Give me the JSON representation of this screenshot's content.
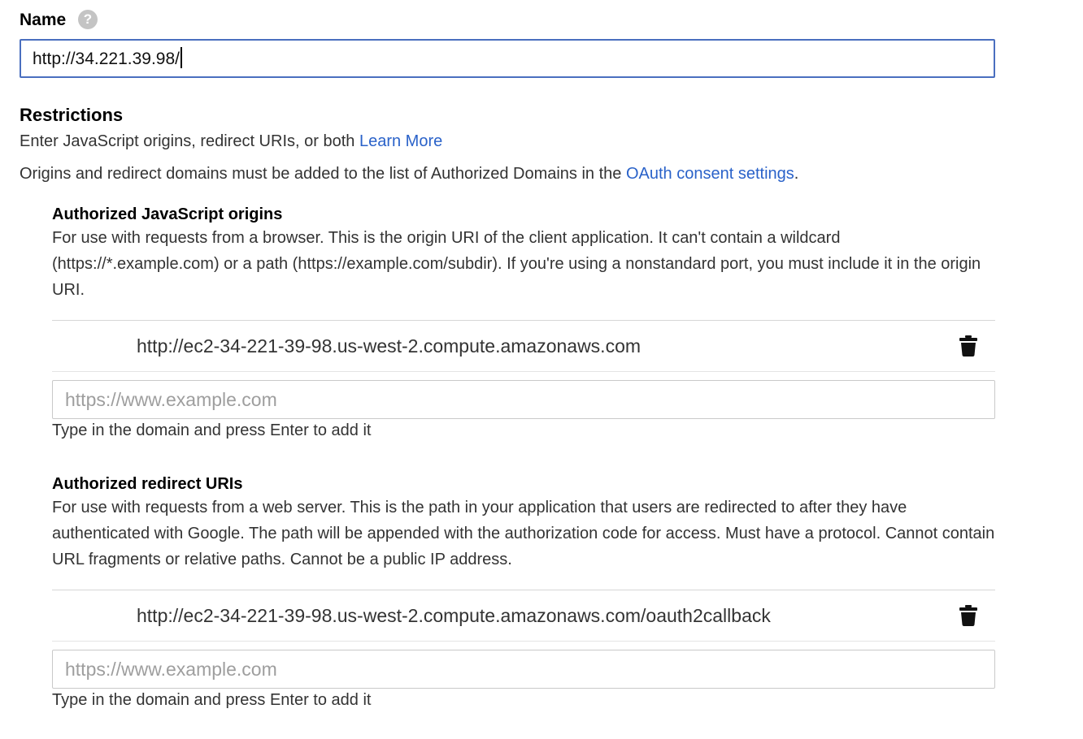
{
  "name": {
    "label": "Name",
    "help_icon": "?",
    "value": "http://34.221.39.98/"
  },
  "restrictions": {
    "title": "Restrictions",
    "desc_text": "Enter JavaScript origins, redirect URIs, or both ",
    "learn_more": "Learn More",
    "note_text": "Origins and redirect domains must be added to the list of Authorized Domains in the ",
    "note_link": "OAuth consent settings",
    "note_end": "."
  },
  "js_origins": {
    "title": "Authorized JavaScript origins",
    "description": "For use with requests from a browser. This is the origin URI of the client application. It can't contain a wildcard (https://*.example.com) or a path (https://example.com/subdir). If you're using a nonstandard port, you must include it in the origin URI.",
    "items": [
      "http://ec2-34-221-39-98.us-west-2.compute.amazonaws.com"
    ],
    "placeholder": "https://www.example.com",
    "hint": "Type in the domain and press Enter to add it",
    "delete_icon": "trash-icon"
  },
  "redirect_uris": {
    "title": "Authorized redirect URIs",
    "description": "For use with requests from a web server. This is the path in your application that users are redirected to after they have authenticated with Google. The path will be appended with the authorization code for access. Must have a protocol. Cannot contain URL fragments or relative paths. Cannot be a public IP address.",
    "items": [
      "http://ec2-34-221-39-98.us-west-2.compute.amazonaws.com/oauth2callback"
    ],
    "placeholder": "https://www.example.com",
    "hint": "Type in the domain and press Enter to add it",
    "delete_icon": "trash-icon"
  }
}
